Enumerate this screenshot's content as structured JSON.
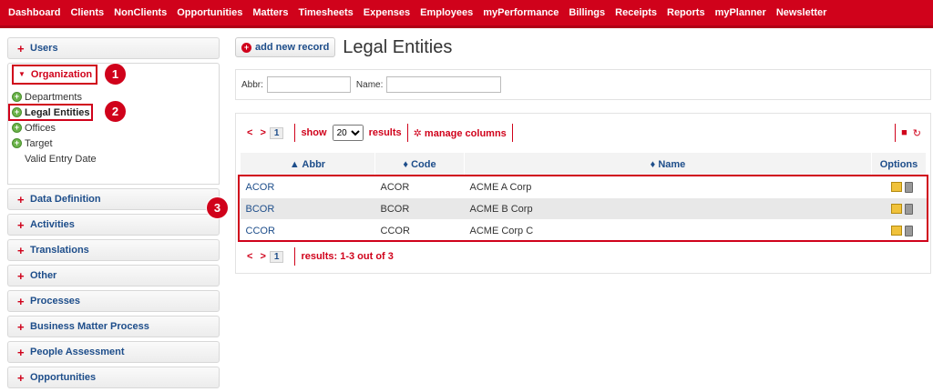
{
  "nav": [
    "Dashboard",
    "Clients",
    "NonClients",
    "Opportunities",
    "Matters",
    "Timesheets",
    "Expenses",
    "Employees",
    "myPerformance",
    "Billings",
    "Receipts",
    "Reports",
    "myPlanner",
    "Newsletter"
  ],
  "sidebar": {
    "users": "Users",
    "organization": "Organization",
    "sub": {
      "departments": "Departments",
      "legal_entities": "Legal Entities",
      "offices": "Offices",
      "target": "Target",
      "valid_entry_date": "Valid Entry Date"
    },
    "items": [
      "Data Definition",
      "Activities",
      "Translations",
      "Other",
      "Processes",
      "Business Matter Process",
      "People Assessment",
      "Opportunities"
    ]
  },
  "badges": [
    "1",
    "2",
    "3"
  ],
  "main": {
    "add_button": "add new record",
    "title": "Legal Entities",
    "filter": {
      "abbr_label": "Abbr:",
      "name_label": "Name:",
      "abbr_value": "",
      "name_value": ""
    },
    "toolbar": {
      "prev": "<",
      "next": ">",
      "page": "1",
      "show": "show",
      "page_size": "20",
      "results": "results",
      "manage_columns": "manage columns"
    },
    "columns": {
      "abbr": "▲ Abbr",
      "code": "♦ Code",
      "name": "♦ Name",
      "options": "Options"
    },
    "rows": [
      {
        "abbr": "ACOR",
        "code": "ACOR",
        "name": "ACME A Corp"
      },
      {
        "abbr": "BCOR",
        "code": "BCOR",
        "name": "ACME B Corp"
      },
      {
        "abbr": "CCOR",
        "code": "CCOR",
        "name": "ACME Corp C"
      }
    ],
    "footer": {
      "results_text": "results: 1-3 out of 3"
    }
  },
  "colors": {
    "brand_red": "#d0021b",
    "link_blue": "#1d4d8a",
    "add_green": "#6bb34a"
  }
}
